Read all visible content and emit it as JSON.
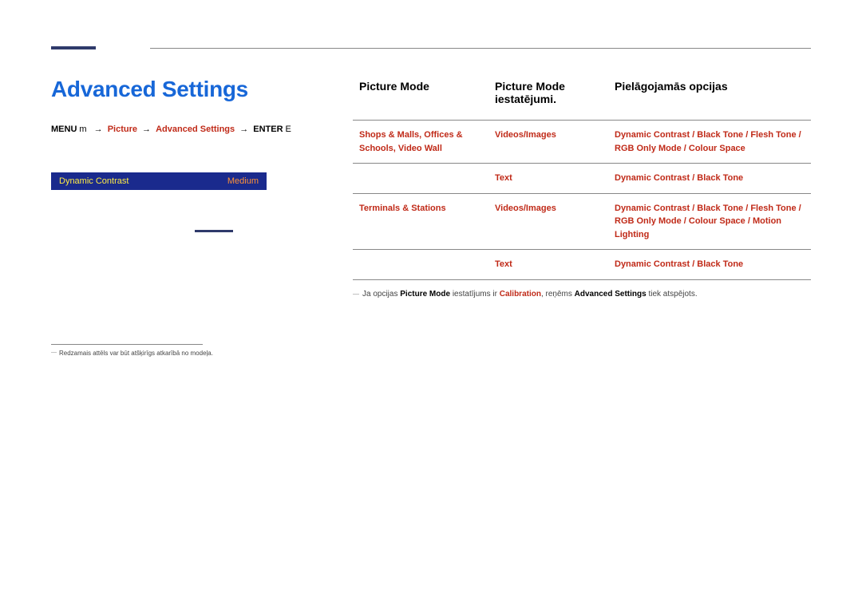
{
  "header": {
    "title": "Advanced Settings"
  },
  "breadcrumb": {
    "k1": "MENU",
    "a1": "m",
    "p1": "Picture",
    "p2": "Advanced Settings",
    "k2": "ENTER",
    "a2": "E"
  },
  "menu": {
    "row": {
      "label": "Dynamic Contrast",
      "value": "Medium"
    }
  },
  "footnote": "Redzamais attēls var būt atšķirīgs atkarībā no modeļa.",
  "table": {
    "h1": "Picture Mode",
    "h2": "Picture Mode iestatējumi.",
    "h3": "Pielāgojamās opcijas",
    "rows": [
      {
        "env": "Shops & Malls, Offices & Schools, Video Wall",
        "mode": "Videos/Images",
        "opts": "Dynamic Contrast / Black Tone / Flesh Tone / RGB Only Mode / Colour Space"
      },
      {
        "env": "",
        "mode": "Text",
        "opts": "Dynamic Contrast / Black Tone"
      },
      {
        "env": "Terminals & Stations",
        "mode": "Videos/Images",
        "opts": "Dynamic Contrast / Black Tone / Flesh Tone / RGB Only Mode / Colour Space / Motion Lighting"
      },
      {
        "env": "",
        "mode": "Text",
        "opts": "Dynamic Contrast / Black Tone"
      }
    ]
  },
  "note": {
    "a": "Ja opcijas ",
    "b": "Picture Mode",
    "c": " iestatījums ir ",
    "d": "Calibration",
    "e": ", reņēms ",
    "f": "Advanced Settings",
    "g": " tiek atspējots."
  }
}
